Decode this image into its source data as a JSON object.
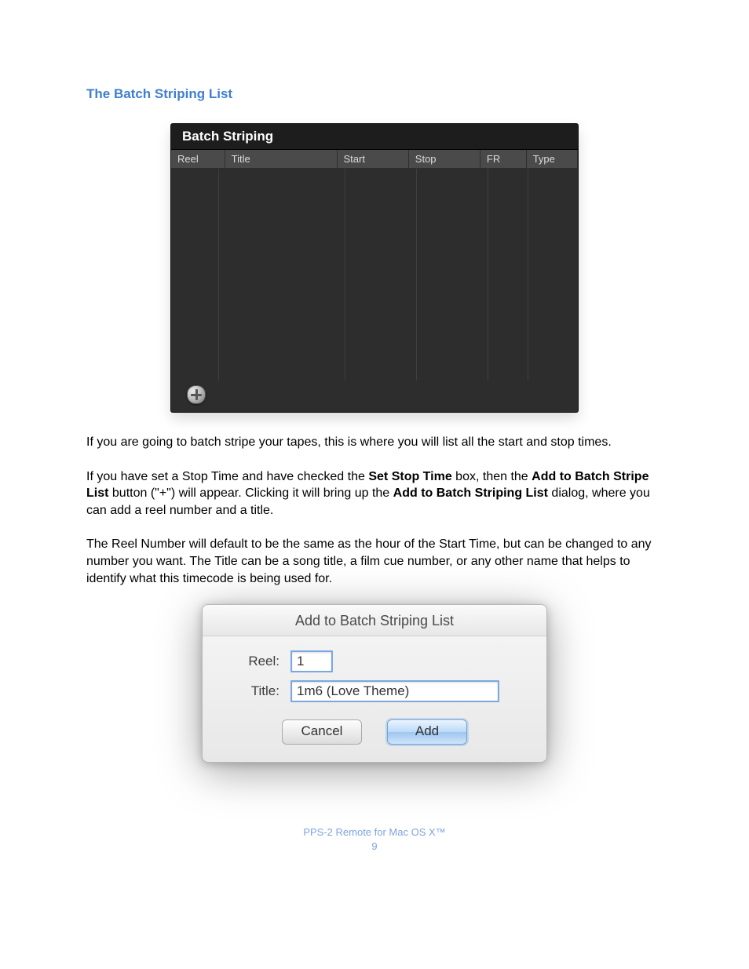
{
  "heading": "The Batch Striping List",
  "panel": {
    "title": "Batch Striping",
    "columns": [
      "Reel",
      "Title",
      "Start",
      "Stop",
      "FR",
      "Type"
    ]
  },
  "paragraphs": {
    "p1": "If you are going to batch stripe your tapes, this is where you will list all the start and stop times.",
    "p2a": "If you have set a Stop Time and have checked the ",
    "p2b": "Set Stop Time",
    "p2c": " box, then the ",
    "p2d": "Add to Batch Stripe List",
    "p2e": " button (\"+\") will appear. Clicking it will bring up the ",
    "p2f": "Add to Batch Striping List",
    "p2g": " dialog, where you can add a reel number and a title.",
    "p3": "The Reel Number will default to be the same as the hour of the Start Time, but can be changed to any number you want. The Title can be a song title, a film cue number, or any other name that helps to identify what this timecode is being used for."
  },
  "dialog": {
    "title": "Add to Batch Striping List",
    "reel_label": "Reel:",
    "reel_value": "1",
    "title_label": "Title:",
    "title_value": "1m6 (Love Theme)",
    "cancel": "Cancel",
    "add": "Add"
  },
  "footer": {
    "line1": "PPS-2 Remote for Mac OS X™",
    "page_no": "9"
  }
}
